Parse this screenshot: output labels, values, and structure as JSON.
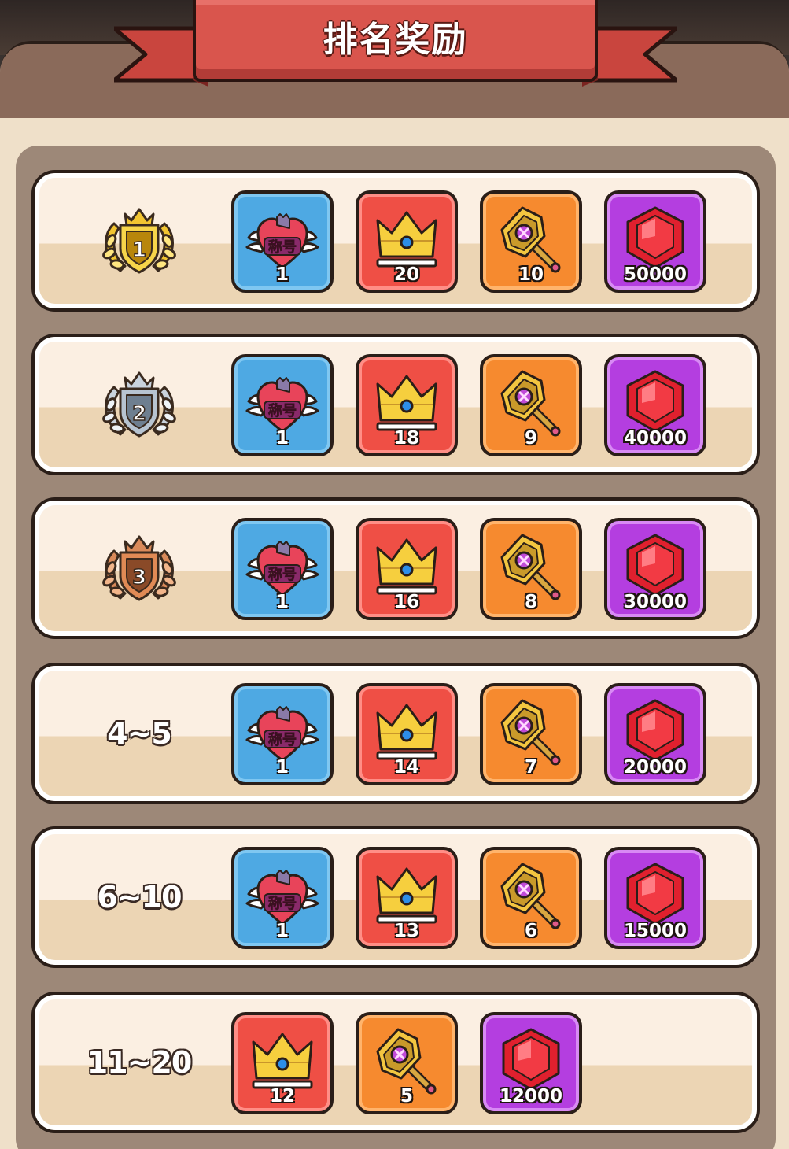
{
  "panel": {
    "title": "排名奖励"
  },
  "rows": [
    {
      "rank_label": "1",
      "badge": "gold-rank-badge",
      "rewards": [
        {
          "type": "title",
          "icon": "winged-heart-title-icon",
          "label": "称号",
          "count": "1"
        },
        {
          "type": "crown",
          "icon": "crown-icon",
          "count": "20"
        },
        {
          "type": "hammer",
          "icon": "hammer-icon",
          "count": "10"
        },
        {
          "type": "gem",
          "icon": "red-gem-icon",
          "count": "50000"
        }
      ]
    },
    {
      "rank_label": "2",
      "badge": "silver-rank-badge",
      "rewards": [
        {
          "type": "title",
          "icon": "winged-heart-title-icon",
          "label": "称号",
          "count": "1"
        },
        {
          "type": "crown",
          "icon": "crown-icon",
          "count": "18"
        },
        {
          "type": "hammer",
          "icon": "hammer-icon",
          "count": "9"
        },
        {
          "type": "gem",
          "icon": "red-gem-icon",
          "count": "40000"
        }
      ]
    },
    {
      "rank_label": "3",
      "badge": "bronze-rank-badge",
      "rewards": [
        {
          "type": "title",
          "icon": "winged-heart-title-icon",
          "label": "称号",
          "count": "1"
        },
        {
          "type": "crown",
          "icon": "crown-icon",
          "count": "16"
        },
        {
          "type": "hammer",
          "icon": "hammer-icon",
          "count": "8"
        },
        {
          "type": "gem",
          "icon": "red-gem-icon",
          "count": "30000"
        }
      ]
    },
    {
      "rank_label": "4~5",
      "rewards": [
        {
          "type": "title",
          "icon": "winged-heart-title-icon",
          "label": "称号",
          "count": "1"
        },
        {
          "type": "crown",
          "icon": "crown-icon",
          "count": "14"
        },
        {
          "type": "hammer",
          "icon": "hammer-icon",
          "count": "7"
        },
        {
          "type": "gem",
          "icon": "red-gem-icon",
          "count": "20000"
        }
      ]
    },
    {
      "rank_label": "6~10",
      "rewards": [
        {
          "type": "title",
          "icon": "winged-heart-title-icon",
          "label": "称号",
          "count": "1"
        },
        {
          "type": "crown",
          "icon": "crown-icon",
          "count": "13"
        },
        {
          "type": "hammer",
          "icon": "hammer-icon",
          "count": "6"
        },
        {
          "type": "gem",
          "icon": "red-gem-icon",
          "count": "15000"
        }
      ]
    },
    {
      "rank_label": "11~20",
      "rewards": [
        {
          "type": "crown",
          "icon": "crown-icon",
          "count": "12"
        },
        {
          "type": "hammer",
          "icon": "hammer-icon",
          "count": "5"
        },
        {
          "type": "gem",
          "icon": "red-gem-icon",
          "count": "12000"
        }
      ]
    }
  ],
  "colors": {
    "title_tile": "#4ea9e3",
    "crown_tile": "#ef4f45",
    "hammer_tile": "#f68a2f",
    "gem_tile": "#b43ee0",
    "ribbon": "#d9554d",
    "row_bg": "#fbefe2"
  }
}
